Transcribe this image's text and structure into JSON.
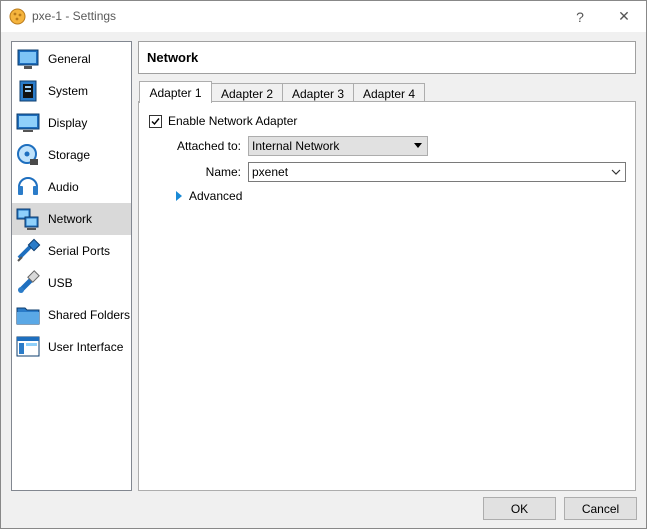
{
  "window": {
    "title": "pxe-1 - Settings",
    "help_glyph": "?",
    "close_glyph": "✕"
  },
  "sidebar": {
    "items": [
      {
        "label": "General",
        "icon": "general-icon"
      },
      {
        "label": "System",
        "icon": "system-icon"
      },
      {
        "label": "Display",
        "icon": "display-icon"
      },
      {
        "label": "Storage",
        "icon": "storage-icon"
      },
      {
        "label": "Audio",
        "icon": "audio-icon"
      },
      {
        "label": "Network",
        "icon": "network-icon"
      },
      {
        "label": "Serial Ports",
        "icon": "serial-ports-icon"
      },
      {
        "label": "USB",
        "icon": "usb-icon"
      },
      {
        "label": "Shared Folders",
        "icon": "shared-folders-icon"
      },
      {
        "label": "User Interface",
        "icon": "user-interface-icon"
      }
    ],
    "selected": "Network"
  },
  "header": {
    "title": "Network"
  },
  "tabs": [
    {
      "label": "Adapter 1",
      "active": true
    },
    {
      "label": "Adapter 2",
      "active": false
    },
    {
      "label": "Adapter 3",
      "active": false
    },
    {
      "label": "Adapter 4",
      "active": false
    }
  ],
  "adapter": {
    "enable_label": "Enable Network Adapter",
    "enabled": true,
    "attached_label": "Attached to:",
    "attached_value": "Internal Network",
    "name_label": "Name:",
    "name_value": "pxenet",
    "advanced_label": "Advanced"
  },
  "buttons": {
    "ok": "OK",
    "cancel": "Cancel"
  },
  "colors": {
    "accent": "#1a8ad6",
    "selected_bg": "#d9d9d9"
  }
}
